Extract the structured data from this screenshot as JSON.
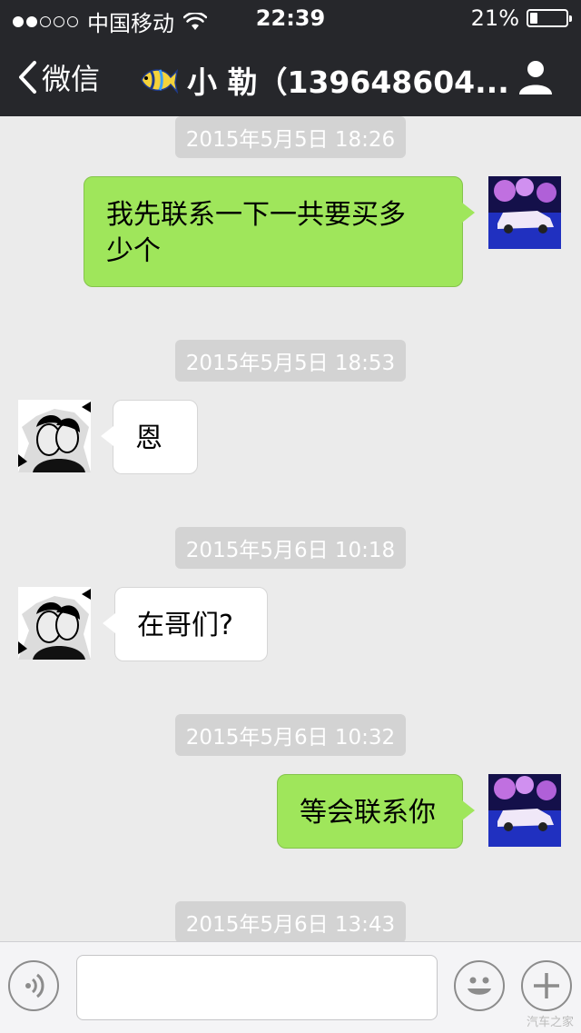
{
  "status_bar": {
    "signal_filled": 2,
    "signal_total": 5,
    "carrier": "中国移动",
    "time": "22:39",
    "battery_percent_label": "21%",
    "battery_level": 0.21
  },
  "nav": {
    "back_label": "微信",
    "title": "小 勒（139648604...",
    "title_icon": "fish-icon",
    "right_icon": "person-icon"
  },
  "messages": [
    {
      "type": "timestamp",
      "text": "2015年5月5日 18:26"
    },
    {
      "type": "outgoing",
      "line1": "我先联系一下一共要买多",
      "line2": "少个",
      "avatar": "car-avatar"
    },
    {
      "type": "timestamp",
      "text": "2015年5月5日 18:53"
    },
    {
      "type": "incoming",
      "text": "恩",
      "avatar": "couple-avatar"
    },
    {
      "type": "timestamp",
      "text": "2015年5月6日 10:18"
    },
    {
      "type": "incoming",
      "text": "在哥们?",
      "avatar": "couple-avatar"
    },
    {
      "type": "timestamp",
      "text": "2015年5月6日 10:32"
    },
    {
      "type": "outgoing",
      "text": "等会联系你",
      "avatar": "car-avatar"
    },
    {
      "type": "timestamp",
      "text": "2015年5月6日 13:43"
    }
  ],
  "input_bar": {
    "voice_icon": "voice-icon",
    "message_value": "",
    "emoji_icon": "emoji-icon",
    "plus_icon": "plus-icon"
  },
  "watermark": "汽车之家",
  "colors": {
    "header_bg": "#26272b",
    "chat_bg": "#ebebeb",
    "outgoing_bubble": "#9fe65b",
    "incoming_bubble": "#ffffff",
    "timestamp_bg": "#d3d3d3"
  }
}
